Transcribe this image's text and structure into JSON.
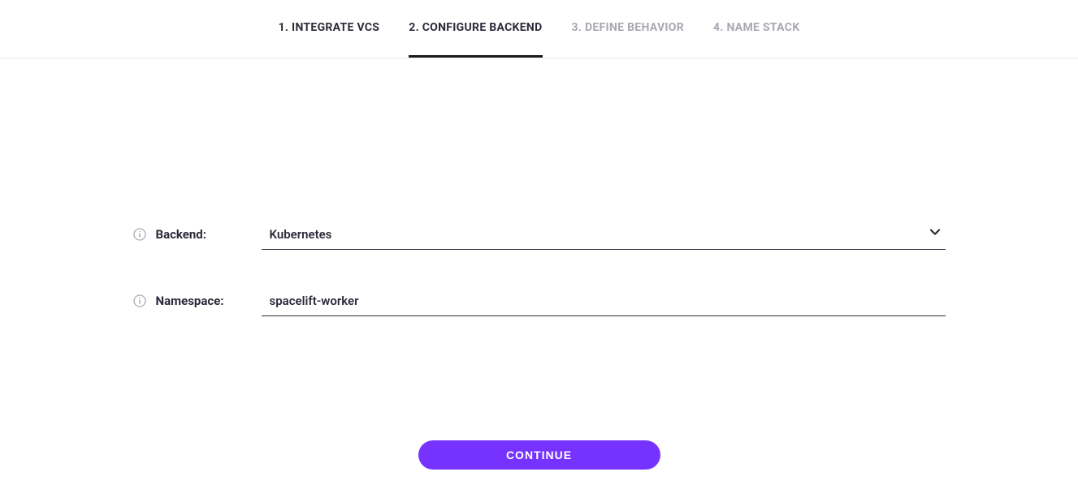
{
  "tabs": {
    "step1": "1. INTEGRATE VCS",
    "step2": "2. CONFIGURE BACKEND",
    "step3": "3. DEFINE BEHAVIOR",
    "step4": "4. NAME STACK"
  },
  "form": {
    "backend": {
      "label": "Backend:",
      "value": "Kubernetes"
    },
    "namespace": {
      "label": "Namespace:",
      "value": "spacelift-worker"
    }
  },
  "actions": {
    "continue": "CONTINUE"
  }
}
